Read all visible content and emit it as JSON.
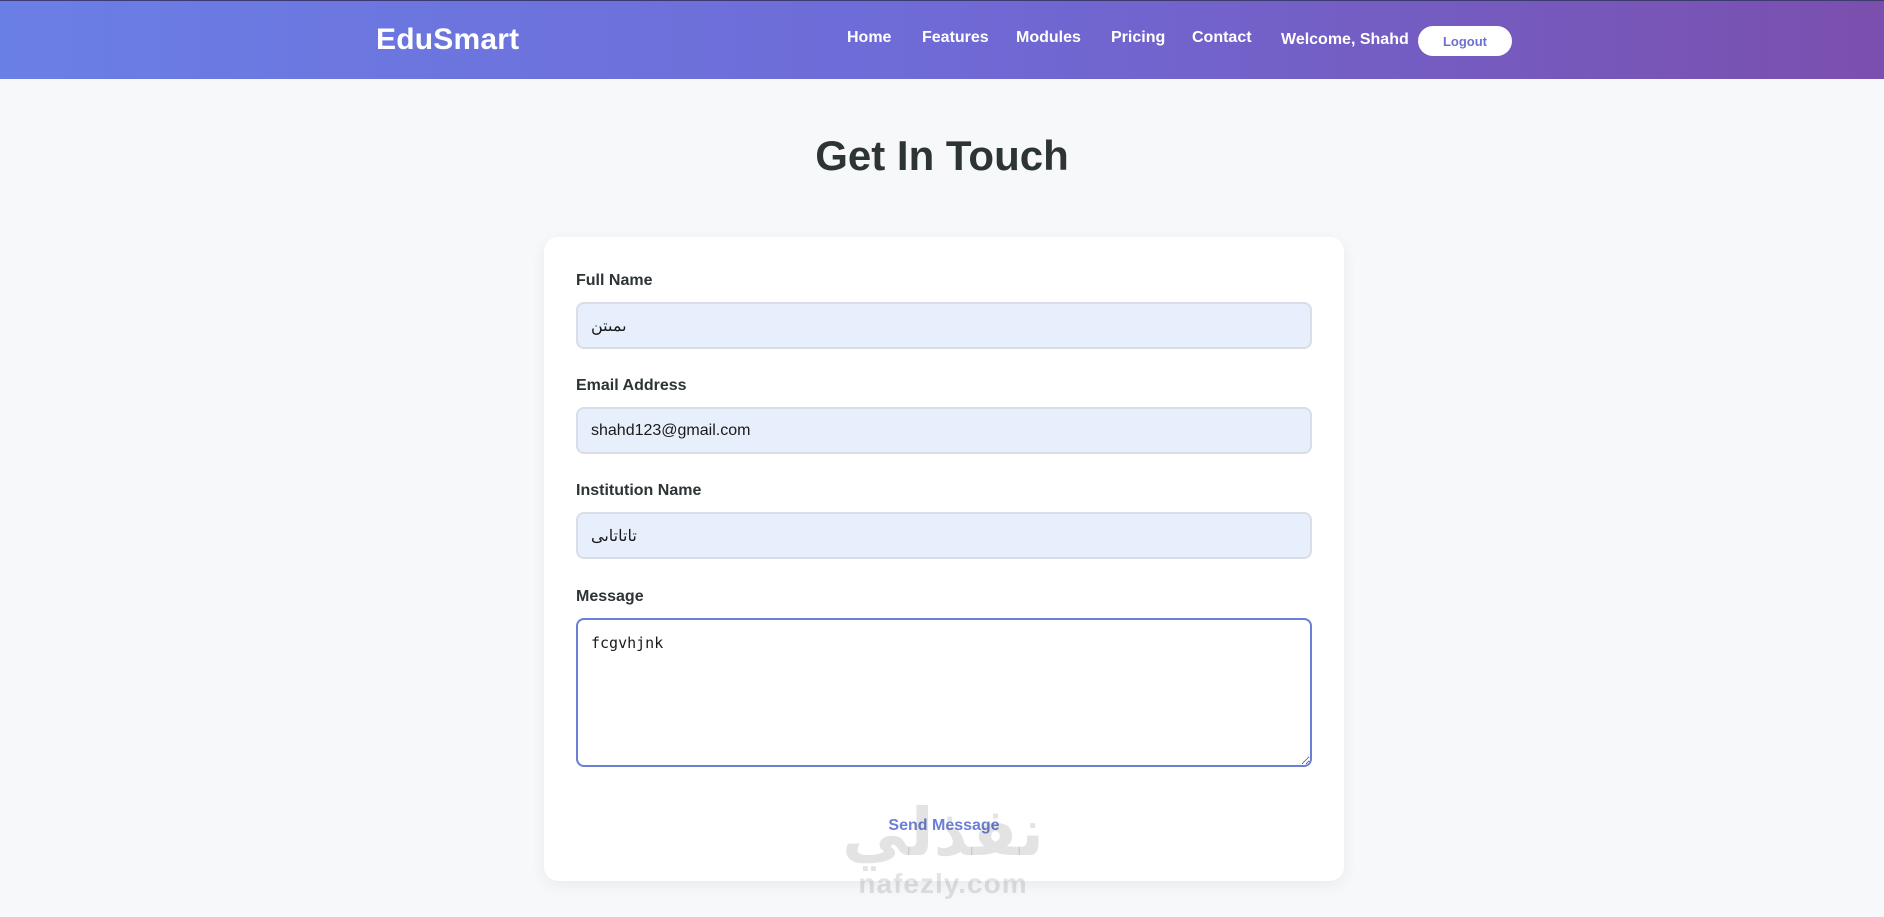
{
  "header": {
    "brand": "EduSmart",
    "nav": [
      "Home",
      "Features",
      "Modules",
      "Pricing",
      "Contact"
    ],
    "welcome": "Welcome, Shahd",
    "logout_label": "Logout"
  },
  "page": {
    "title": "Get In Touch"
  },
  "form": {
    "full_name": {
      "label": "Full Name",
      "value": "ىمىتن"
    },
    "email": {
      "label": "Email Address",
      "value": "shahd123@gmail.com"
    },
    "institution": {
      "label": "Institution Name",
      "value": "تاتاتاىى"
    },
    "message": {
      "label": "Message",
      "value": "fcgvhjnk"
    },
    "submit_label": "Send Message"
  },
  "watermark": {
    "arabic": "نفذلي",
    "latin": "nafezly.com"
  },
  "colors": {
    "accent": "#6a7fd6",
    "header_start": "#6a7fe6",
    "header_end": "#7a4fae",
    "input_bg": "#e8effc"
  }
}
